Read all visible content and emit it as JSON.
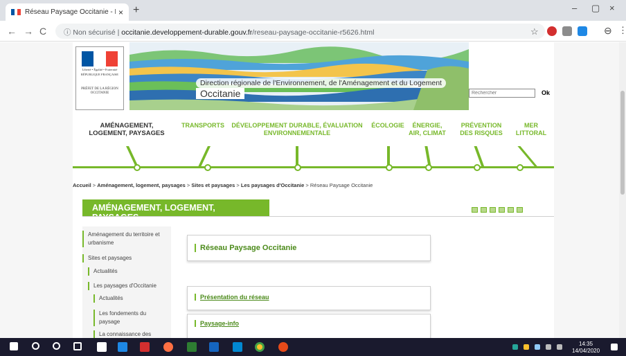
{
  "tab": {
    "title": "Réseau Paysage Occitanie - DRE/",
    "close": "×"
  },
  "newtab": "+",
  "window": {
    "minimize": "–",
    "maximize": "▢",
    "close": "×"
  },
  "nav_buttons": {
    "back": "←",
    "forward": "→",
    "reload": "C"
  },
  "address": {
    "security": "ⓘ Non sécurisé",
    "separator": "|",
    "domain": "occitanie.developpement-durable.gouv.fr",
    "path": "/reseau-paysage-occitanie-r5626.html"
  },
  "toolbar_icons": {
    "star": "☆",
    "menu": "⋮",
    "profile": "⊖"
  },
  "marianne": {
    "tagline": "Liberté • Égalité • Fraternité",
    "republic": "RÉPUBLIQUE FRANÇAISE",
    "prefet": "PRÉFET DE LA RÉGION OCCITANIE"
  },
  "header": {
    "direction": "Direction régionale de l'Environnement, de l'Aménagement et du Logement",
    "region": "Occitanie"
  },
  "search": {
    "placeholder": "Rechercher",
    "button": "Ok"
  },
  "nav": [
    {
      "label": "AMÉNAGEMENT, LOGEMENT, PAYSAGES"
    },
    {
      "label": "TRANSPORTS"
    },
    {
      "label": "DÉVELOPPEMENT DURABLE, ÉVALUATION ENVIRONNEMENTALE"
    },
    {
      "label": "ÉCOLOGIE"
    },
    {
      "label": "ÉNERGIE, AIR, CLIMAT"
    },
    {
      "label": "PRÉVENTION DES RISQUES"
    },
    {
      "label": "MER LITTORAL"
    }
  ],
  "breadcrumb": {
    "home": "Accueil",
    "sep": " > ",
    "b1": "Aménagement, logement, paysages",
    "b2": "Sites et paysages",
    "b3": "Les paysages d'Occitanie",
    "current": "Réseau Paysage Occitanie"
  },
  "section_title": "AMÉNAGEMENT, LOGEMENT, PAYSAGES",
  "sidebar": [
    {
      "label": "Aménagement du territoire et urbanisme"
    },
    {
      "label": "Sites et paysages"
    },
    {
      "label": "Actualités"
    },
    {
      "label": "Les paysages d'Occitanie"
    },
    {
      "label": "Actualités"
    },
    {
      "label": "Les fondements du paysage"
    },
    {
      "label": "La connaissance des"
    }
  ],
  "content": {
    "title": "Réseau Paysage Occitanie",
    "links": [
      "Présentation du réseau",
      "Paysage-info"
    ]
  },
  "taskbar": {
    "time": "14:35",
    "date": "14/04/2020"
  },
  "colors": {
    "accent": "#77b82a",
    "link": "#4b8a1a",
    "taskbar": "#1a1a2e"
  }
}
